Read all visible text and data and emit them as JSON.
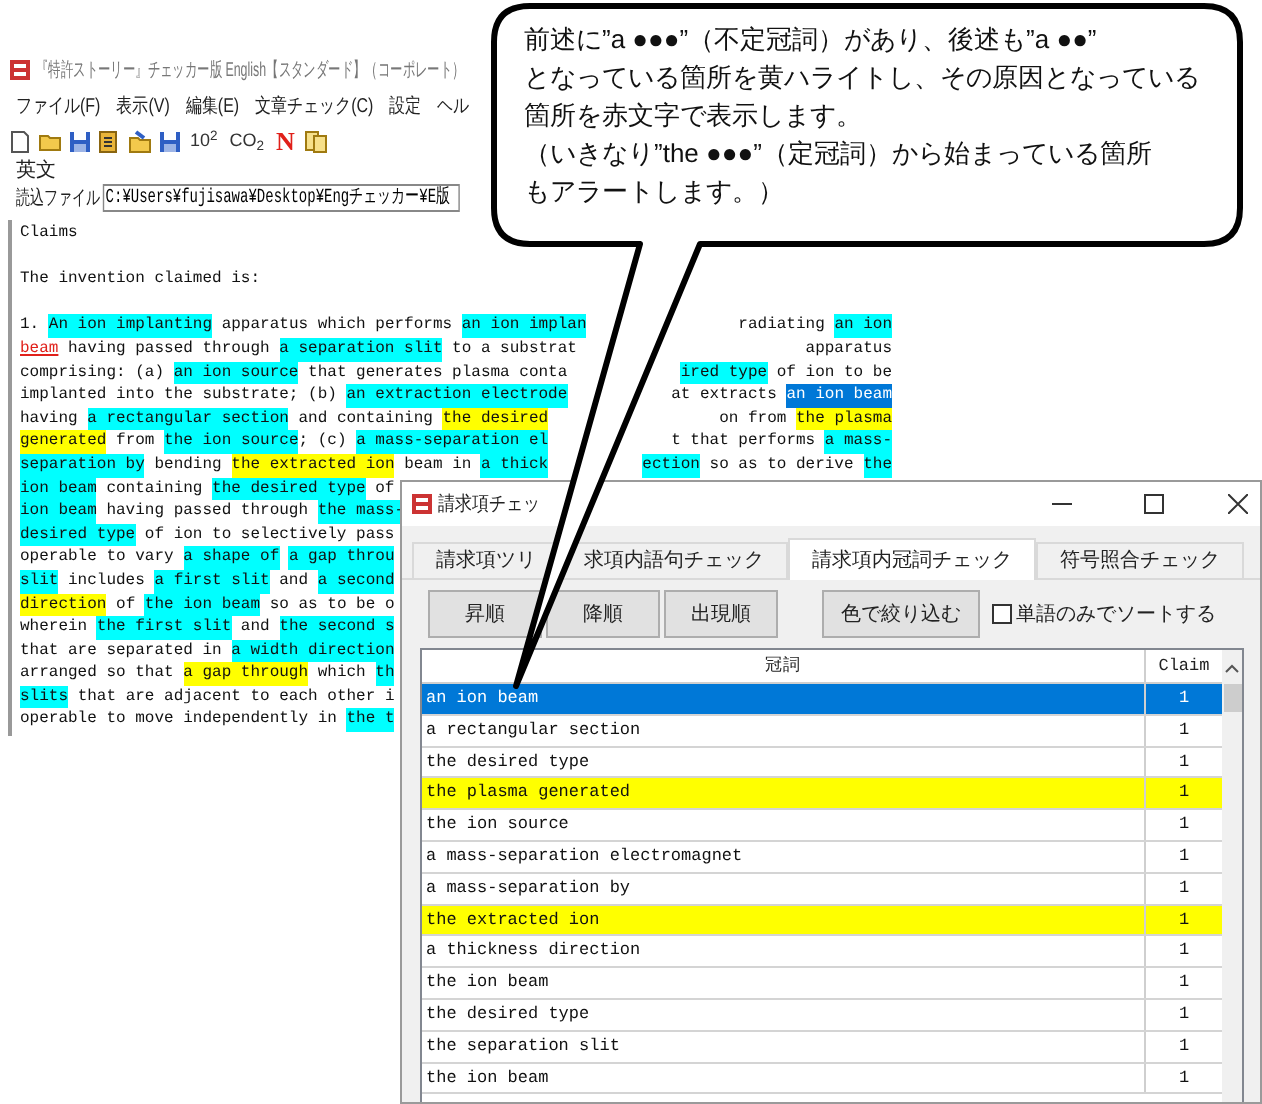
{
  "window": {
    "title": "『特許ストーリー』チェッカー版 English【スタンダード】（コーポレート）"
  },
  "menu": [
    "ファイル(F)",
    "表示(V)",
    "編集(E)",
    "文章チェック(C)",
    "設定",
    "ヘル"
  ],
  "toolbar": [
    {
      "kind": "new"
    },
    {
      "kind": "open"
    },
    {
      "kind": "save"
    },
    {
      "kind": "edit"
    },
    {
      "kind": "export"
    },
    {
      "kind": "save"
    },
    {
      "kind": "text",
      "label": "10$^{2}$"
    },
    {
      "kind": "text",
      "label": "CO$_{2}$"
    },
    {
      "kind": "letter",
      "label": "N"
    },
    {
      "kind": "copy"
    }
  ],
  "group": {
    "label": "英文",
    "file_label": "読込ファイル",
    "file_path": "C:¥Users¥fujisawa¥Desktop¥Engチェッカー¥E版"
  },
  "claims_text": {
    "heading": "Claims",
    "intro": "The invention claimed is:",
    "lines": [
      {
        "left": [
          {
            "text": "1. "
          },
          {
            "text": "An ion implanting",
            "kind": "cyan"
          },
          {
            "text": " apparatus which performs "
          },
          {
            "text": "an ion implan",
            "kind": "cyan"
          }
        ],
        "right": [
          {
            "text": "radiating "
          },
          {
            "text": "an ion",
            "kind": "cyan"
          }
        ]
      },
      {
        "left": [
          {
            "text": "beam",
            "kind": "error"
          },
          {
            "text": " having passed through "
          },
          {
            "text": "a separation slit",
            "kind": "cyan"
          },
          {
            "text": " to a substrat"
          }
        ],
        "right": [
          {
            "text": "apparatus"
          }
        ]
      },
      {
        "left": [
          {
            "text": "comprising: (a) "
          },
          {
            "text": "an ion source",
            "kind": "cyan"
          },
          {
            "text": " that generates plasma conta"
          }
        ],
        "right": [
          {
            "text": "ired type",
            "kind": "cyan"
          },
          {
            "text": " of ion to be"
          }
        ]
      },
      {
        "left": [
          {
            "text": "implanted into the substrate; (b) "
          },
          {
            "text": "an extraction electrode",
            "kind": "cyan"
          }
        ],
        "right": [
          {
            "text": "at extracts "
          },
          {
            "text": "an ion beam",
            "kind": "selected"
          }
        ]
      },
      {
        "left": [
          {
            "text": "having "
          },
          {
            "text": "a rectangular section",
            "kind": "cyan"
          },
          {
            "text": " and containing "
          },
          {
            "text": "the desired",
            "kind": "yellow"
          }
        ],
        "right": [
          {
            "text": "on from "
          },
          {
            "text": "the plasma",
            "kind": "yellow"
          }
        ]
      },
      {
        "left": [
          {
            "text": "generated",
            "kind": "yellow"
          },
          {
            "text": " from "
          },
          {
            "text": "the ion source",
            "kind": "cyan"
          },
          {
            "text": "; (c) "
          },
          {
            "text": "a mass-separation el",
            "kind": "cyan"
          }
        ],
        "right": [
          {
            "text": "t that performs "
          },
          {
            "text": "a mass-",
            "kind": "cyan"
          }
        ]
      },
      {
        "left": [
          {
            "text": "separation by",
            "kind": "cyan"
          },
          {
            "text": " bending "
          },
          {
            "text": "the extracted ion",
            "kind": "yellow"
          },
          {
            "text": " beam in "
          },
          {
            "text": "a thick",
            "kind": "cyan"
          }
        ],
        "right": [
          {
            "text": "ection",
            "kind": "cyan"
          },
          {
            "text": " so as to derive "
          },
          {
            "text": "the",
            "kind": "cyan"
          }
        ]
      },
      {
        "left": [
          {
            "text": "ion beam",
            "kind": "cyan"
          },
          {
            "text": " containing "
          },
          {
            "text": "the desired type",
            "kind": "cyan"
          },
          {
            "text": " of"
          }
        ]
      },
      {
        "left": [
          {
            "text": "ion beam",
            "kind": "cyan"
          },
          {
            "text": " having passed through "
          },
          {
            "text": "the mass-",
            "kind": "cyan"
          }
        ]
      },
      {
        "left": [
          {
            "text": "desired type",
            "kind": "cyan"
          },
          {
            "text": " of ion to selectively pass"
          }
        ]
      },
      {
        "left": [
          {
            "text": "operable to vary "
          },
          {
            "text": "a shape of",
            "kind": "cyan"
          },
          {
            "text": "a gap throu",
            "kind": "cyan"
          }
        ]
      },
      {
        "left": [
          {
            "text": "slit",
            "kind": "cyan"
          },
          {
            "text": " includes "
          },
          {
            "text": "a first slit",
            "kind": "cyan"
          },
          {
            "text": " and "
          },
          {
            "text": "a second",
            "kind": "cyan"
          }
        ]
      },
      {
        "left": [
          {
            "text": "direction",
            "kind": "yellow"
          },
          {
            "text": " of "
          },
          {
            "text": "the ion beam",
            "kind": "cyan"
          },
          {
            "text": " so as to be o"
          }
        ]
      },
      {
        "left": [
          {
            "text": "wherein "
          },
          {
            "text": "the first slit",
            "kind": "cyan"
          },
          {
            "text": " and "
          },
          {
            "text": "the second s",
            "kind": "cyan"
          }
        ]
      },
      {
        "left": [
          {
            "text": "that are separated in "
          },
          {
            "text": "a width direction",
            "kind": "cyan"
          }
        ]
      },
      {
        "left": [
          {
            "text": "arranged so that "
          },
          {
            "text": "a gap through",
            "kind": "yellow"
          },
          {
            "text": " which "
          },
          {
            "text": "th",
            "kind": "cyan"
          }
        ]
      },
      {
        "left": [
          {
            "text": "slits",
            "kind": "cyan"
          },
          {
            "text": " that are adjacent to each other i"
          }
        ]
      },
      {
        "left": [
          {
            "text": "operable to move independently in "
          },
          {
            "text": "the t",
            "kind": "cyan"
          }
        ]
      }
    ]
  },
  "dialog": {
    "title": "請求項チェッ",
    "tabs": [
      {
        "label": "請求項ツリ",
        "selected": false
      },
      {
        "label": "求項内語句チェック",
        "selected": false
      },
      {
        "label": "請求項内冠詞チェック",
        "selected": true
      },
      {
        "label": "符号照合チェック",
        "selected": false
      }
    ],
    "buttons": [
      "昇順",
      "降順",
      "出現順"
    ],
    "filter_button": "色で絞り込む",
    "checkbox": {
      "label": "単語のみでソートする",
      "checked": false
    },
    "table": {
      "columns": [
        "冠詞",
        "Claim"
      ],
      "rows": [
        {
          "text": "an ion beam",
          "claim": "1",
          "selected": true,
          "flagged": false
        },
        {
          "text": "a rectangular section",
          "claim": "1",
          "selected": false,
          "flagged": false
        },
        {
          "text": "the desired type",
          "claim": "1",
          "selected": false,
          "flagged": false
        },
        {
          "text": "the plasma generated",
          "claim": "1",
          "selected": false,
          "flagged": true
        },
        {
          "text": "the ion source",
          "claim": "1",
          "selected": false,
          "flagged": false
        },
        {
          "text": "a mass-separation electromagnet",
          "claim": "1",
          "selected": false,
          "flagged": false
        },
        {
          "text": "a mass-separation by",
          "claim": "1",
          "selected": false,
          "flagged": false
        },
        {
          "text": "the extracted ion",
          "claim": "1",
          "selected": false,
          "flagged": true
        },
        {
          "text": "a thickness direction",
          "claim": "1",
          "selected": false,
          "flagged": false
        },
        {
          "text": "the ion beam",
          "claim": "1",
          "selected": false,
          "flagged": false
        },
        {
          "text": "the desired type",
          "claim": "1",
          "selected": false,
          "flagged": false
        },
        {
          "text": "the separation slit",
          "claim": "1",
          "selected": false,
          "flagged": false
        },
        {
          "text": "the ion beam",
          "claim": "1",
          "selected": false,
          "flagged": false
        }
      ]
    }
  },
  "callout": {
    "lines": [
      "前述に”a ●●●”（不定冠詞）があり、後述も”a ●●”",
      "となっている箇所を黄ハライトし、その原因となっている",
      "箇所を赤文字で表示します。",
      "（いきなり”the ●●●”（定冠詞）から始まっている箇所",
      "もアラートします。）"
    ]
  }
}
